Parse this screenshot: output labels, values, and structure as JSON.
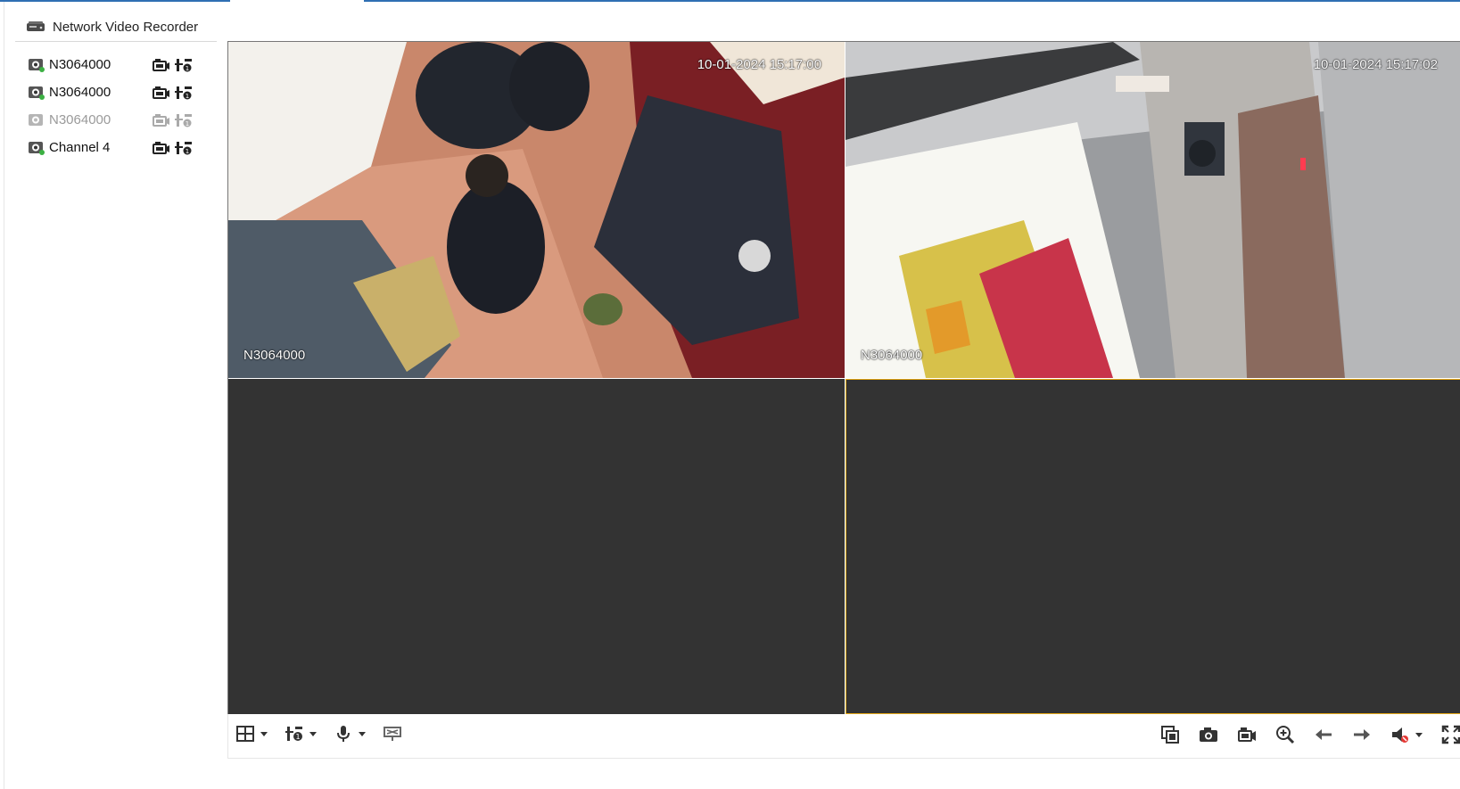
{
  "app": {
    "accent_color": "#2f6fb3",
    "selected_pane_color": "#e6a817"
  },
  "sidebar": {
    "device_title": "Network Video Recorder",
    "device_icon": "nvr-device-icon",
    "channels": [
      {
        "label": "N3064000",
        "status": "online",
        "icons": [
          "camera-online-icon",
          "record-icon",
          "stream-info-icon"
        ]
      },
      {
        "label": "N3064000",
        "status": "online",
        "icons": [
          "camera-online-icon",
          "record-icon",
          "stream-info-icon"
        ]
      },
      {
        "label": "N3064000",
        "status": "offline",
        "icons": [
          "camera-offline-icon",
          "record-icon",
          "stream-info-icon"
        ]
      },
      {
        "label": "Channel 4",
        "status": "online",
        "icons": [
          "camera-online-icon",
          "record-icon",
          "stream-info-icon"
        ]
      }
    ]
  },
  "panes": [
    {
      "timestamp": "10-01-2024 15:17:00",
      "camera_name": "N3064000",
      "has_video": true
    },
    {
      "timestamp": "10-01-2024 15:17:02",
      "camera_name": "N3064000",
      "has_video": true
    },
    {
      "has_video": false
    },
    {
      "has_video": false,
      "selected": true
    }
  ],
  "toolbar": {
    "left": [
      "layout-grid-icon",
      "stream-select-icon",
      "microphone-icon",
      "ptz-icon"
    ],
    "right": [
      "close-all-icon",
      "snapshot-icon",
      "record-all-icon",
      "digital-zoom-icon",
      "previous-page-icon",
      "next-page-icon",
      "volume-muted-icon",
      "fullscreen-icon"
    ]
  }
}
